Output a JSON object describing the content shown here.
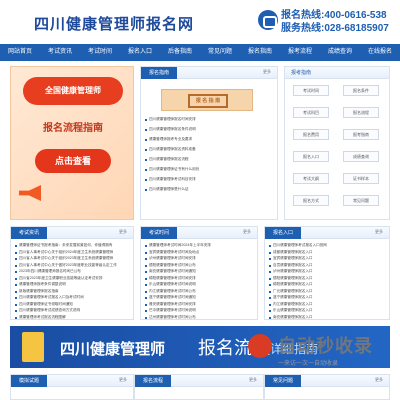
{
  "header": {
    "logo": "四川健康管理师报名网",
    "hotline_label": "报名热线:400-0616-538",
    "service_label": "服务热线:028-68185907"
  },
  "nav": [
    "网站首页",
    "考试资讯",
    "考试时间",
    "报名入口",
    "后备指南",
    "常见问题",
    "报名指南",
    "报考流程",
    "成绩查询",
    "在线报名"
  ],
  "banner": {
    "top": "全国健康管理师",
    "title": "报名流程指南",
    "button": "点击查看"
  },
  "guide_panel": {
    "tag": "报名指南",
    "more": "更多",
    "banner_text": "报 名 指 南",
    "items": [
      "四川健康管理师报名时间安排",
      "四川健康管理师报名条件说明",
      "健康管理师报考专业及要求",
      "四川健康管理师报名资料准备",
      "四川健康管理师报名流程",
      "四川健康管理师证书有什么用处",
      "四川健康管理师考试科目安排",
      "四川健康管理师是什么证"
    ]
  },
  "exam_guide": {
    "title": "报考指南",
    "items": [
      "考试时间",
      "报名条件",
      "考试科目",
      "报名流程",
      "报名费用",
      "报考指南",
      "报名入口",
      "成绩查询",
      "考试大纲",
      "证书样本",
      "报名方式",
      "常见问题"
    ]
  },
  "news_left": {
    "tag": "考试资讯",
    "more": "更多",
    "items": [
      "健康管理师证书报考指南：未来发展前景如何，你值得拥有",
      "四川省人事考试中心关于组织2024年度卫生系统健康管理师",
      "四川省人事考试中心关于组织2023年度卫生系统健康管理师",
      "四川省人事考试中心关于做好2023年度职业技能等级认定工作",
      "2023年四川健康管理师报名时间已公布",
      "四川省2023年度卫生健康职业技能等级认定考试安排",
      "健康管理师报考条件调整说明",
      "新版健康管理师报名指南",
      "四川健康管理师考试报名入口及考试时间",
      "四川健康管理师证书领取时间通知",
      "四川健康管理师考试成绩查询方式说明",
      "健康管理师考试报名流程图解"
    ]
  },
  "news_mid": {
    "tag": "考试时间",
    "more": "更多",
    "items": [
      "健康管理师考试时间2024年上半年安排",
      "宜宾健康管理师考试时间及地点",
      "泸州健康管理师考试时间安排",
      "德阳健康管理师考试时间公布",
      "南充健康管理师考试时间通知",
      "绵阳健康管理师考试时间安排",
      "乐山健康管理师考试时间说明",
      "内江健康管理师考试时间公布",
      "遂宁健康管理师考试时间通知",
      "雅安健康管理师考试时间安排",
      "巴中健康管理师考试时间说明",
      "达州健康管理师考试时间公布"
    ]
  },
  "news_right": {
    "tag": "报名入口",
    "more": "更多",
    "items": [
      "四川健康管理师考试报名入口官网",
      "成都健康管理师报名入口",
      "宜宾健康管理师报名入口",
      "自贡健康管理师报名入口",
      "泸州健康管理师报名入口",
      "德阳健康管理师报名入口",
      "绵阳健康管理师报名入口",
      "广元健康管理师报名入口",
      "遂宁健康管理师报名入口",
      "内江健康管理师报名入口",
      "乐山健康管理师报名入口",
      "南充健康管理师报名入口"
    ]
  },
  "bottom_banner": {
    "text1": "四川健康管理师",
    "text2": "报名流程",
    "text3": "详细指南"
  },
  "watermark": {
    "title": "自动秒收录",
    "sub": "一来访一次一自动收录"
  },
  "footer": {
    "left_tag": "模拟试题",
    "mid_tag": "报名流程",
    "right_tag": "常见问题",
    "more": "更多"
  }
}
